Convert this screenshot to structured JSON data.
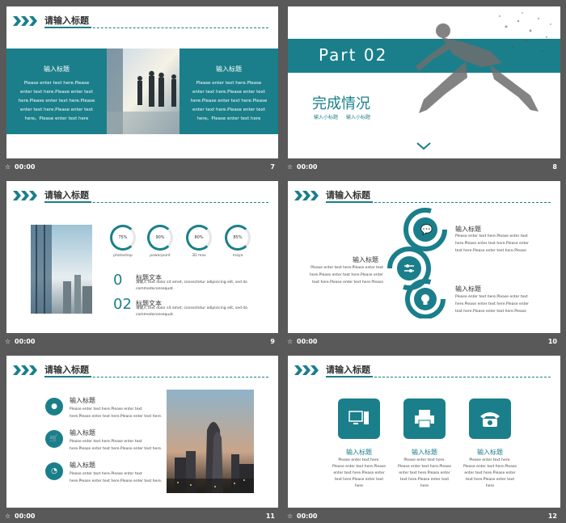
{
  "colors": {
    "accent": "#1a7f8a",
    "background": "#595959"
  },
  "common": {
    "header_title": "请输入标题",
    "footer_time": "00:00",
    "footer_icon": "star-icon"
  },
  "slide7": {
    "number": "7",
    "panel_left": {
      "title": "输入标题",
      "text": [
        "Please enter text here.Please",
        "enter text here.Please enter text",
        "here.Please enter text here.Please",
        "enter text here.Please enter text",
        "here。Please enter text here"
      ]
    },
    "panel_right": {
      "title": "输入标题",
      "text": [
        "Please enter text here.Please",
        "enter text here.Please enter text",
        "here.Please enter text here.Please",
        "enter text here.Please enter text",
        "here。Please enter text here"
      ]
    }
  },
  "slide8": {
    "number": "8",
    "part": "Part  02",
    "title": "完成情况",
    "sub1": "输入小标题",
    "sub2": "输入小标题"
  },
  "slide9": {
    "number": "9",
    "stats": [
      {
        "value": "75%",
        "label": "photoshop"
      },
      {
        "value": "90%",
        "label": "powerpoint"
      },
      {
        "value": "80%",
        "label": "3D max"
      },
      {
        "value": "85%",
        "label": "maya"
      }
    ],
    "items": [
      {
        "num": "0",
        "title": "标题文本",
        "text": [
          "请输入 text dolor sit amet, consectetur adipisicing elit, sed do",
          "commodoconsequat."
        ]
      },
      {
        "num": "02",
        "title": "标题文本",
        "text": [
          "请输入 text dolor sit amet, consectetur adipisicing elit, sed do",
          "commodoconsequat."
        ]
      }
    ]
  },
  "slide10": {
    "number": "10",
    "top_right": {
      "title": "输入标题",
      "text": [
        "Please enter text here.Please enter text",
        "here.Please enter text here.Please enter",
        "text here.Please enter text here.Please"
      ]
    },
    "left": {
      "title": "输入标题",
      "text": [
        "Please enter text here.Please enter text",
        "here.Please enter text here.Please enter",
        "text here.Please enter text here.Please"
      ]
    },
    "bottom_right": {
      "title": "输入标题",
      "text": [
        "Please enter text here.Please enter text",
        "here.Please enter text here.Please enter",
        "text here.Please enter text here.Please"
      ]
    }
  },
  "slide11": {
    "number": "11",
    "items": [
      {
        "title": "输入标题",
        "icon": "user-icon",
        "text": [
          "Please enter text here.Please enter text",
          "here.Please enter text here.Please enter text here."
        ]
      },
      {
        "title": "输入标题",
        "icon": "cart-icon",
        "text": [
          "Please enter text here.Please enter text",
          "here.Please enter text here.Please enter text here."
        ]
      },
      {
        "title": "输入标题",
        "icon": "gauge-icon",
        "text": [
          "Please enter text here.Please enter text",
          "here.Please enter text here.Please enter text here."
        ]
      }
    ]
  },
  "slide12": {
    "number": "12",
    "cards": [
      {
        "title": "输入标题",
        "icon": "computer-icon",
        "text": [
          "Please enter text here.",
          "Please enter text here.Please",
          "enter text here.Please enter",
          "text here.Please enter text",
          "here"
        ]
      },
      {
        "title": "输入标题",
        "icon": "printer-icon",
        "text": [
          "Please enter text here.",
          "Please enter text here.Please",
          "enter text here.Please enter",
          "text here.Please enter text",
          "here"
        ]
      },
      {
        "title": "输入标题",
        "icon": "telephone-icon",
        "text": [
          "Please enter text here.",
          "Please enter text here.Please",
          "enter text here.Please enter",
          "text here.Please enter text",
          "here"
        ]
      }
    ]
  }
}
